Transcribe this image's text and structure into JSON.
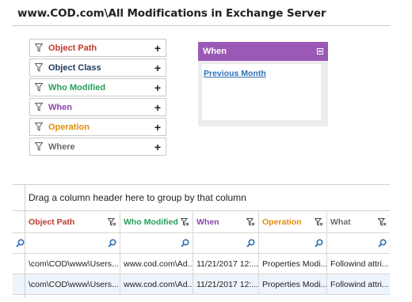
{
  "page": {
    "title": "www.COD.com\\All Modifications in Exchange Server"
  },
  "filters": [
    {
      "label": "Object Path",
      "color": "#c0392b"
    },
    {
      "label": "Object Class",
      "color": "#1f3a5a"
    },
    {
      "label": "Who Modified",
      "color": "#27a05a"
    },
    {
      "label": "When",
      "color": "#8e44ad"
    },
    {
      "label": "Operation",
      "color": "#e08e0b"
    },
    {
      "label": "Where",
      "color": "#6b6b6b"
    }
  ],
  "when_panel": {
    "title": "When",
    "link": "Previous Month"
  },
  "grid": {
    "group_hint": "Drag a column header here to group by that column",
    "columns": [
      {
        "label": "Object Path",
        "color": "#c0392b"
      },
      {
        "label": "Who Modified",
        "color": "#27a05a"
      },
      {
        "label": "When",
        "color": "#8e44ad"
      },
      {
        "label": "Operation",
        "color": "#e08e0b"
      },
      {
        "label": "What",
        "color": "#6b6b6b"
      }
    ],
    "rows": [
      [
        "\\com\\COD\\www\\Users...",
        "www.cod.com\\Ad...",
        "11/21/2017 12:...",
        "Properties Modi...",
        "Followind attri..."
      ],
      [
        "\\com\\COD\\www\\Users...",
        "www.cod.com\\Ad...",
        "11/21/2017 12:...",
        "Properties Modi...",
        "Followind attri..."
      ]
    ]
  }
}
